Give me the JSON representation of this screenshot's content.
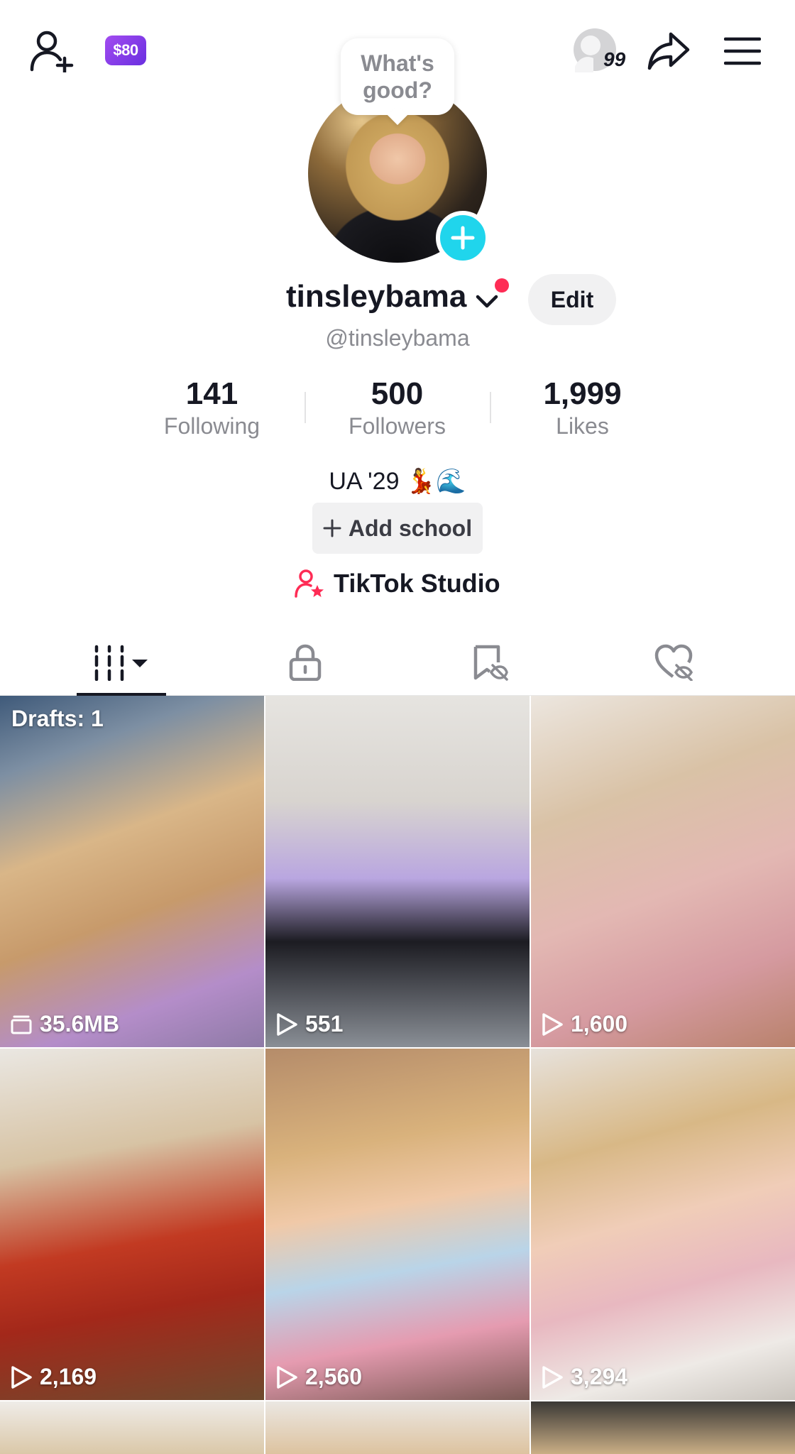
{
  "header": {
    "coins_badge": "$80",
    "notification_count": "99",
    "status_bubble": "What's good?"
  },
  "profile": {
    "username": "tinsleybama",
    "handle": "@tinsleybama",
    "edit_label": "Edit",
    "bio": "UA '29 💃🌊",
    "add_school_label": "Add school",
    "studio_label": "TikTok Studio"
  },
  "stats": [
    {
      "value": "141",
      "label": "Following"
    },
    {
      "value": "500",
      "label": "Followers"
    },
    {
      "value": "1,999",
      "label": "Likes"
    }
  ],
  "tabs": [
    {
      "name": "videos-tab",
      "icon": "grid-bars-icon"
    },
    {
      "name": "private-tab",
      "icon": "lock-icon"
    },
    {
      "name": "favorites-tab",
      "icon": "bookmark-hidden-icon"
    },
    {
      "name": "liked-tab",
      "icon": "heart-hidden-icon"
    }
  ],
  "videos": [
    {
      "overlay": "Drafts: 1",
      "size": "35.6MB"
    },
    {
      "views": "551"
    },
    {
      "views": "1,600"
    },
    {
      "views": "2,169"
    },
    {
      "views": "2,560"
    },
    {
      "views": "3,294"
    }
  ],
  "colors": {
    "accent": "#fe2c55",
    "plus": "#20d5ec",
    "coins": "#8a3ee8"
  }
}
